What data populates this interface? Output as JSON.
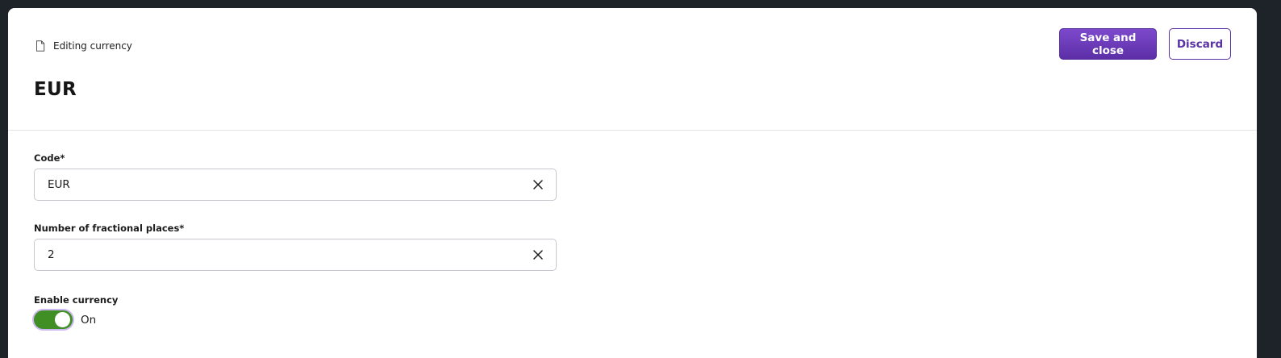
{
  "header": {
    "breadcrumb_icon": "document-icon",
    "breadcrumb": "Editing currency",
    "title": "EUR"
  },
  "actions": {
    "save_label": "Save and close",
    "discard_label": "Discard"
  },
  "form": {
    "code": {
      "label": "Code*",
      "value": "EUR",
      "clear_icon": "close-icon"
    },
    "fractional_places": {
      "label": "Number of fractional places*",
      "value": "2",
      "clear_icon": "close-icon"
    },
    "enable_currency": {
      "label": "Enable currency",
      "checked": true,
      "state_label": "On"
    }
  },
  "colors": {
    "primary": "#6a3cc0",
    "toggle_on": "#3f8f24",
    "focus_ring": "#cdb7f3"
  }
}
